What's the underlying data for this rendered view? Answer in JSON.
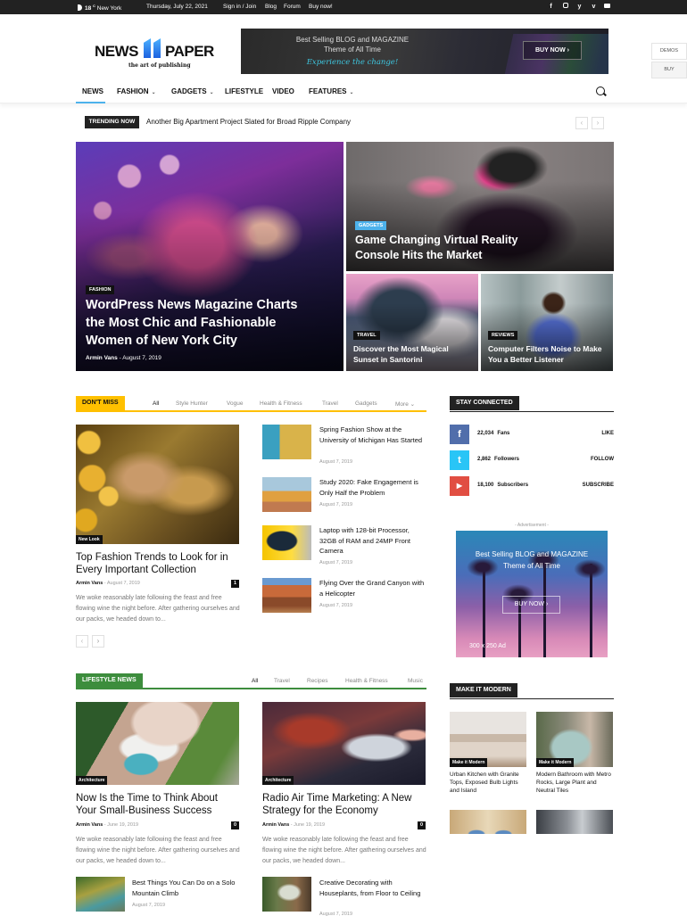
{
  "topbar": {
    "temperature": "18",
    "temp_unit": "C",
    "city": "New York",
    "date": "Thursday, July 22, 2021",
    "links": [
      "Sign in / Join",
      "Blog",
      "Forum",
      "Buy now!"
    ],
    "social_icons": [
      "facebook-icon",
      "instagram-icon",
      "twitter-icon",
      "vimeo-icon",
      "youtube-icon"
    ]
  },
  "logo": {
    "word_left": "NEWS",
    "word_right": "PAPER",
    "tagline": "the art of publishing"
  },
  "header_ad": {
    "line1": "Best Selling BLOG and MAGAZINE",
    "line2": "Theme of All Time",
    "line3": "Experience the change!",
    "button": "BUY NOW ›"
  },
  "side_buttons": {
    "demos": "DEMOS",
    "buy": "BUY"
  },
  "nav": {
    "items": [
      {
        "label": "NEWS",
        "dropdown": false,
        "active": true
      },
      {
        "label": "FASHION",
        "dropdown": true
      },
      {
        "label": "GADGETS",
        "dropdown": true
      },
      {
        "label": "LIFESTYLE",
        "dropdown": false
      },
      {
        "label": "VIDEO",
        "dropdown": false
      },
      {
        "label": "FEATURES",
        "dropdown": true
      }
    ],
    "chevron": "⌄",
    "accent": "#4db2ec"
  },
  "trending": {
    "label": "TRENDING NOW",
    "headline": "Another Big Apartment Project Slated for Broad Ripple Company",
    "prev": "‹",
    "next": "›"
  },
  "hero": {
    "main": {
      "category": "FASHION",
      "title": "WordPress News Magazine Charts the Most Chic and Fashionable Women of New York City",
      "author": "Armin Vans",
      "date": "August 7, 2019"
    },
    "vr": {
      "category": "GADGETS",
      "category_color": "#4db2ec",
      "title": "Game Changing Virtual Reality Console Hits the Market"
    },
    "santorini": {
      "category": "TRAVEL",
      "title": "Discover the Most Magical Sunset in Santorini"
    },
    "listener": {
      "category": "REVIEWS",
      "title": "Computer Filters Noise to Make You a Better Listener"
    }
  },
  "dont_miss": {
    "label": "DON'T MISS",
    "color": "#ffc000",
    "filters": [
      "All",
      "Style Hunter",
      "Vogue",
      "Health & Fitness",
      "Travel",
      "Gadgets",
      "More"
    ],
    "featured": {
      "category": "New Look",
      "title": "Top Fashion Trends to Look for in Every Important Collection",
      "author": "Armin Vans",
      "date": "August 7, 2019",
      "comments": "1",
      "excerpt": "We woke reasonably late following the feast and free flowing wine the night before. After gathering ourselves and our packs, we headed down to..."
    },
    "list": [
      {
        "title": "Spring Fashion Show at the University of Michigan Has Started",
        "date": "August 7, 2019"
      },
      {
        "title": "Study 2020: Fake Engagement is Only Half the Problem",
        "date": "August 7, 2019"
      },
      {
        "title": "Laptop with 128-bit Processor, 32GB of RAM and 24MP Front Camera",
        "date": "August 7, 2019"
      },
      {
        "title": "Flying Over the Grand Canyon with a Helicopter",
        "date": "August 7, 2019"
      }
    ],
    "prev": "‹",
    "next": "›"
  },
  "stay_connected": {
    "label": "STAY CONNECTED",
    "rows": [
      {
        "network": "facebook",
        "icon": "f",
        "color": "#516eab",
        "count": "22,034",
        "unit": "Fans",
        "action": "LIKE"
      },
      {
        "network": "twitter",
        "icon": "t",
        "color": "#29c5f6",
        "count": "2,862",
        "unit": "Followers",
        "action": "FOLLOW"
      },
      {
        "network": "youtube",
        "icon": "▶",
        "color": "#e14e42",
        "count": "18,100",
        "unit": "Subscribers",
        "action": "SUBSCRIBE"
      }
    ]
  },
  "side_ad": {
    "label": "- Advertisement -",
    "line1": "Best Selling BLOG and MAGAZINE",
    "line2": "Theme of All Time",
    "button": "BUY NOW ›",
    "size": "300 x 250 Ad"
  },
  "lifestyle": {
    "label": "LIFESTYLE NEWS",
    "color": "#3d8d3d",
    "filters": [
      "All",
      "Travel",
      "Recipes",
      "Health & Fitness",
      "Music"
    ],
    "featured": [
      {
        "category": "Architecture",
        "title": "Now Is the Time to Think About Your Small-Business Success",
        "author": "Armin Vans",
        "date": "June 19, 2019",
        "comments": "0",
        "excerpt": "We woke reasonably late following the feast and free flowing wine the night before. After gathering ourselves and our packs, we headed down to..."
      },
      {
        "category": "Architecture",
        "title": "Radio Air Time Marketing: A New Strategy for the Economy",
        "author": "Armin Vans",
        "date": "June 19, 2019",
        "comments": "0",
        "excerpt": "We woke reasonably late following the feast and free flowing wine the night before. After gathering ourselves and our packs, we headed down..."
      }
    ],
    "list": [
      {
        "title": "Best Things You Can Do on a Solo Mountain Climb",
        "date": "August 7, 2019"
      },
      {
        "title": "Creative Decorating with Houseplants, from Floor to Ceiling",
        "date": "August 7, 2019"
      }
    ]
  },
  "make_it_modern": {
    "label": "MAKE IT MODERN",
    "items": [
      {
        "category": "Make it Modern",
        "title": "Urban Kitchen with Granite Tops, Exposed Bulb Lights and Island"
      },
      {
        "category": "Make it Modern",
        "title": "Modern Bathroom with Metro Rocks, Large Plant and Neutral Tiles"
      }
    ]
  }
}
